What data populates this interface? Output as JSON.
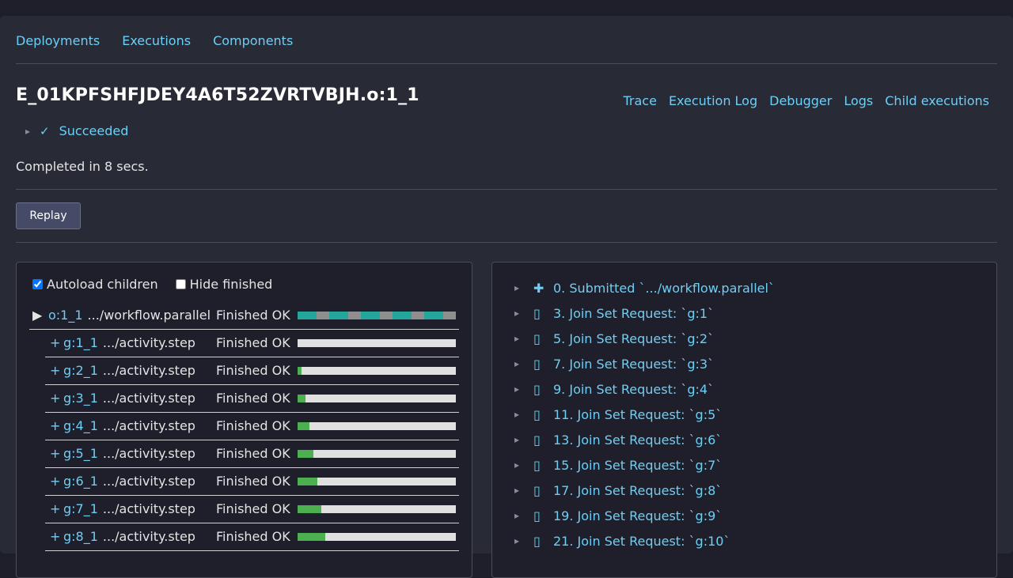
{
  "nav": {
    "deployments": "Deployments",
    "executions": "Executions",
    "components": "Components"
  },
  "execution": {
    "id": "E_01KPFSHFJDEY4A6T52ZVRTVBJH.o:1_1",
    "status_arrow": "▸",
    "status_check": "✓",
    "status": "Succeeded",
    "completed": "Completed in 8 secs."
  },
  "actions": {
    "trace": "Trace",
    "execution_log": "Execution Log",
    "debugger": "Debugger",
    "logs": "Logs",
    "child_executions": "Child executions"
  },
  "replay_label": "Replay",
  "tree": {
    "autoload_label": "Autoload children",
    "autoload_checked": true,
    "hide_finished_label": "Hide finished",
    "hide_finished_checked": false,
    "root": {
      "toggle": "▶",
      "id": "o:1_1",
      "fn": ".../workflow.parallel",
      "status": "Finished OK",
      "segments": [
        "teal",
        "gray",
        "teal",
        "gray",
        "teal",
        "gray",
        "teal",
        "gray",
        "teal",
        "gray"
      ]
    },
    "children": [
      {
        "toggle": "+",
        "id": "g:1_1",
        "fn": ".../activity.step",
        "status": "Finished OK",
        "progress": 0.0
      },
      {
        "toggle": "+",
        "id": "g:2_1",
        "fn": ".../activity.step",
        "status": "Finished OK",
        "progress": 0.025
      },
      {
        "toggle": "+",
        "id": "g:3_1",
        "fn": ".../activity.step",
        "status": "Finished OK",
        "progress": 0.05
      },
      {
        "toggle": "+",
        "id": "g:4_1",
        "fn": ".../activity.step",
        "status": "Finished OK",
        "progress": 0.075
      },
      {
        "toggle": "+",
        "id": "g:5_1",
        "fn": ".../activity.step",
        "status": "Finished OK",
        "progress": 0.1
      },
      {
        "toggle": "+",
        "id": "g:6_1",
        "fn": ".../activity.step",
        "status": "Finished OK",
        "progress": 0.125
      },
      {
        "toggle": "+",
        "id": "g:7_1",
        "fn": ".../activity.step",
        "status": "Finished OK",
        "progress": 0.15
      },
      {
        "toggle": "+",
        "id": "g:8_1",
        "fn": ".../activity.step",
        "status": "Finished OK",
        "progress": 0.175
      }
    ]
  },
  "events": [
    {
      "arrow": "▸",
      "icon": "✚",
      "icon_name": "plus-icon",
      "text": "0. Submitted `.../workflow.parallel`"
    },
    {
      "arrow": "▸",
      "icon": "▯",
      "icon_name": "join-set-icon",
      "text": "3. Join Set Request: `g:1`"
    },
    {
      "arrow": "▸",
      "icon": "▯",
      "icon_name": "join-set-icon",
      "text": "5. Join Set Request: `g:2`"
    },
    {
      "arrow": "▸",
      "icon": "▯",
      "icon_name": "join-set-icon",
      "text": "7. Join Set Request: `g:3`"
    },
    {
      "arrow": "▸",
      "icon": "▯",
      "icon_name": "join-set-icon",
      "text": "9. Join Set Request: `g:4`"
    },
    {
      "arrow": "▸",
      "icon": "▯",
      "icon_name": "join-set-icon",
      "text": "11. Join Set Request: `g:5`"
    },
    {
      "arrow": "▸",
      "icon": "▯",
      "icon_name": "join-set-icon",
      "text": "13. Join Set Request: `g:6`"
    },
    {
      "arrow": "▸",
      "icon": "▯",
      "icon_name": "join-set-icon",
      "text": "15. Join Set Request: `g:7`"
    },
    {
      "arrow": "▸",
      "icon": "▯",
      "icon_name": "join-set-icon",
      "text": "17. Join Set Request: `g:8`"
    },
    {
      "arrow": "▸",
      "icon": "▯",
      "icon_name": "join-set-icon",
      "text": "19. Join Set Request: `g:9`"
    },
    {
      "arrow": "▸",
      "icon": "▯",
      "icon_name": "join-set-icon",
      "text": "21. Join Set Request: `g:10`"
    }
  ],
  "colors": {
    "link": "#6dcff6",
    "teal": "#26a69a",
    "gray": "#8f8f8f",
    "green": "#4caf50",
    "track": "#e0e0e0"
  }
}
